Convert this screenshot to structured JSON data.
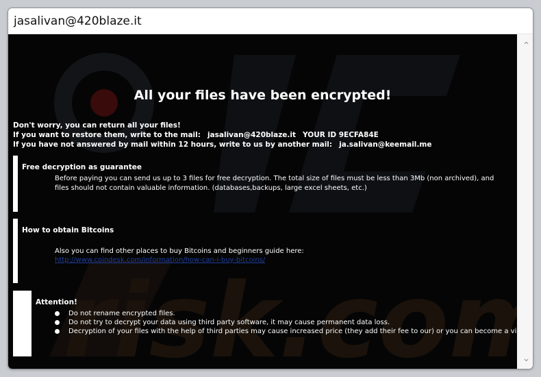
{
  "window": {
    "title": "jasalivan@420blaze.it"
  },
  "note": {
    "headline": "All your files have been encrypted!",
    "line1": "Don't worry, you can return all your files!",
    "line2_prefix": "If you want to restore them, write to the mail:",
    "line2_email": "jasalivan@420blaze.it",
    "line2_id": "YOUR ID 9ECFA84E",
    "line3_prefix": "If you have not answered by mail within 12 hours, write to us by another mail:",
    "line3_email": "ja.salivan@keemail.me",
    "sections": [
      {
        "title": "Free decryption as guarantee",
        "body": "Before paying you can send us up to 3 files for free decryption. The total size of files must be less than 3Mb (non archived), and files should not contain valuable information. (databases,backups, large excel sheets, etc.)"
      },
      {
        "title": "How to obtain Bitcoins",
        "body": "Also you can find other places to buy Bitcoins and beginners guide here:",
        "link": "http://www.coindesk.com/information/how-can-i-buy-bitcoins/"
      },
      {
        "title": "Attention!",
        "bullets": [
          "Do not rename encrypted files.",
          "Do not try to decrypt your data using third party software, it may cause permanent data loss.",
          "Decryption of your files with the help of third parties may cause increased price (they add their fee to our) or you can become a victim of a scam."
        ]
      }
    ]
  },
  "colors": {
    "background": "#050505",
    "text": "#ffffff",
    "link": "#1f3f9e"
  },
  "icons": {
    "scroll_up": "chevron-up-icon",
    "scroll_down": "chevron-down-icon"
  }
}
